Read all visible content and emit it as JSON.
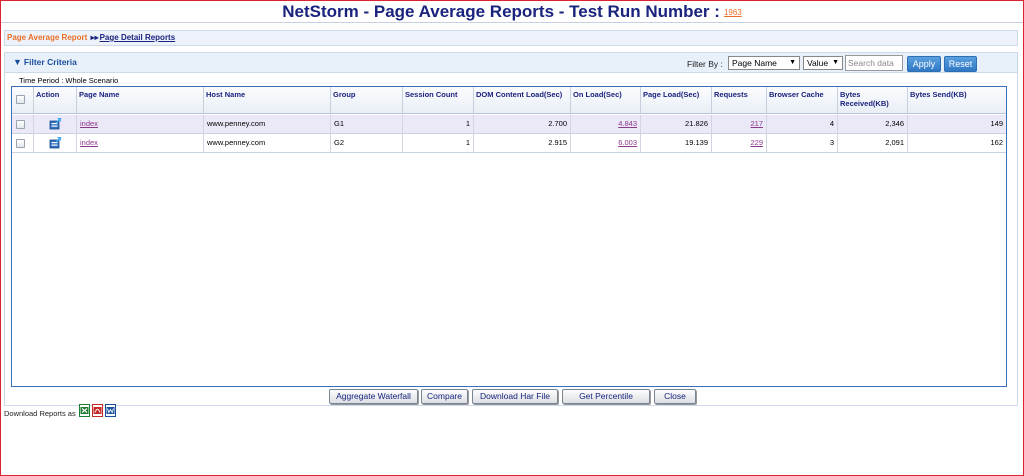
{
  "header": {
    "title": "NetStorm - Page Average Reports - Test Run Number :",
    "test_run_number": "1963"
  },
  "breadcrumb": {
    "active": "Page Average Report",
    "separator": "▸▸",
    "link": "Page Detail Reports"
  },
  "filter": {
    "title": "Filter Criteria",
    "filter_by_label": "Filter By :",
    "field_select": "Page Name",
    "value_select": "Value",
    "search_placeholder": "Search data",
    "apply_label": "Apply",
    "reset_label": "Reset"
  },
  "time_period": "Time Period : Whole Scenario",
  "table": {
    "columns": [
      "Action",
      "Page Name",
      "Host Name",
      "Group",
      "Session Count",
      "DOM Content Load(Sec)",
      "On Load(Sec)",
      "Page Load(Sec)",
      "Requests",
      "Browser Cache",
      "Bytes Received(KB)",
      "Bytes Send(KB)"
    ],
    "rows": [
      {
        "page_name": "index",
        "host_name": "www.penney.com",
        "group": "G1",
        "session_count": "1",
        "dom_content_load": "2.700",
        "on_load": "4.843",
        "page_load": "21.826",
        "requests": "217",
        "browser_cache": "4",
        "bytes_received": "2,346",
        "bytes_send": "149"
      },
      {
        "page_name": "index",
        "host_name": "www.penney.com",
        "group": "G2",
        "session_count": "1",
        "dom_content_load": "2.915",
        "on_load": "6.003",
        "page_load": "19.139",
        "requests": "229",
        "browser_cache": "3",
        "bytes_received": "2,091",
        "bytes_send": "162"
      }
    ]
  },
  "actions": {
    "aggregate_waterfall": "Aggregate Waterfall",
    "compare": "Compare",
    "download_har": "Download Har File",
    "get_percentile": "Get Percentile",
    "close": "Close"
  },
  "download": {
    "label": "Download Reports as",
    "formats": [
      "excel-icon",
      "pdf-icon",
      "word-icon"
    ]
  }
}
